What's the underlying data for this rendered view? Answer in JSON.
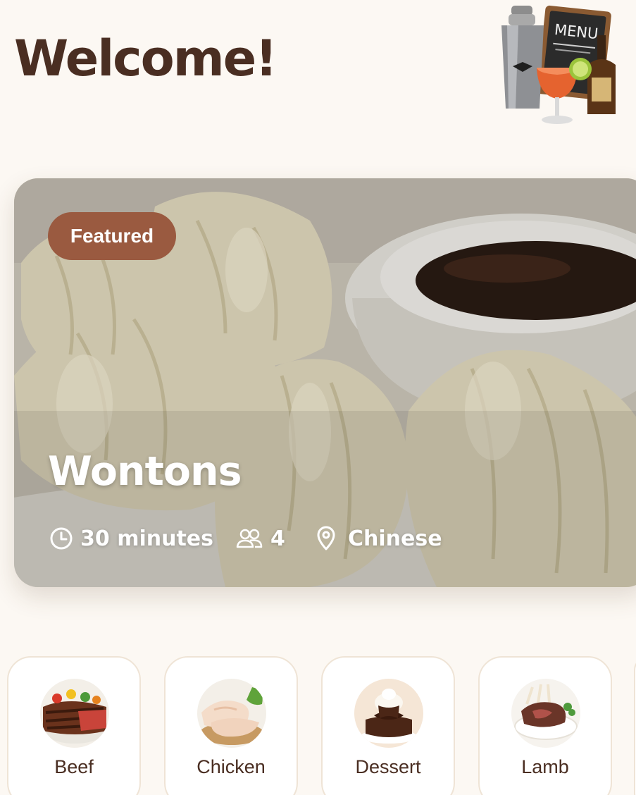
{
  "header": {
    "title": "Welcome!",
    "icon": "bar-menu-icon",
    "icon_text": "MENU"
  },
  "featured": {
    "badge": "Featured",
    "title": "Wontons",
    "time": "30 minutes",
    "servings": "4",
    "cuisine": "Chinese",
    "icons": [
      "clock-icon",
      "people-icon",
      "location-pin-icon"
    ]
  },
  "categories": [
    {
      "label": "Beef",
      "icon": "beef-steak-icon"
    },
    {
      "label": "Chicken",
      "icon": "chicken-icon"
    },
    {
      "label": "Dessert",
      "icon": "dessert-cake-icon"
    },
    {
      "label": "Lamb",
      "icon": "lamb-chops-icon"
    }
  ],
  "colors": {
    "background": "#fcf8f3",
    "title": "#4a2e22",
    "badge": "#9a5a40",
    "card_border": "#efe4d6"
  }
}
